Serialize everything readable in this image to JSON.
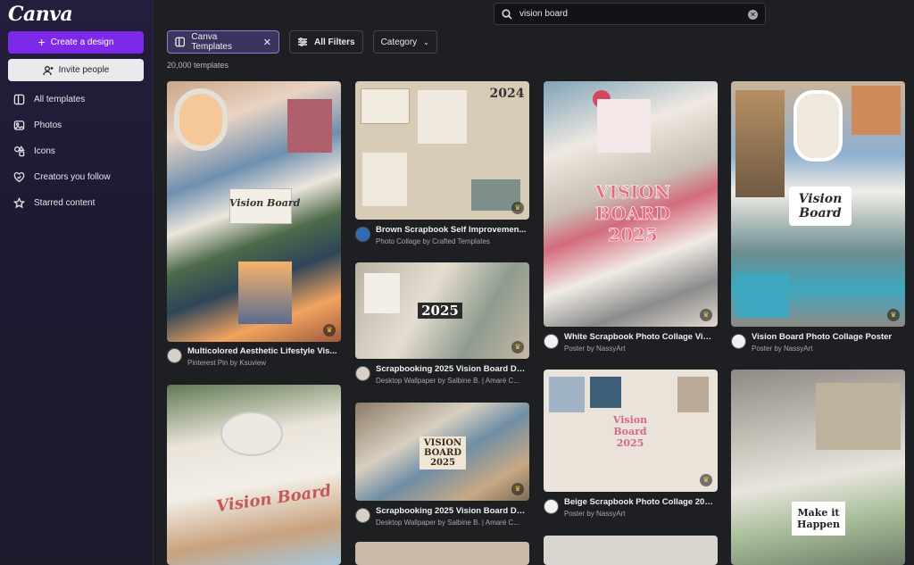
{
  "app": {
    "logo": "Canva",
    "create_label": "Create a design",
    "invite_label": "Invite people"
  },
  "sidebar": {
    "items": [
      {
        "label": "All templates",
        "icon": "templates-icon"
      },
      {
        "label": "Photos",
        "icon": "photos-icon"
      },
      {
        "label": "Icons",
        "icon": "shapes-icon"
      },
      {
        "label": "Creators you follow",
        "icon": "heart-follow-icon"
      },
      {
        "label": "Starred content",
        "icon": "star-icon"
      }
    ]
  },
  "search": {
    "value": "vision board"
  },
  "filters": {
    "active_chip": "Canva Templates",
    "all_filters": "All Filters",
    "category": "Category"
  },
  "results": {
    "count": "20,000 templates"
  },
  "cards": [
    {
      "title": "Multicolored Aesthetic Lifestyle Vis...",
      "sub": "Pinterest Pin by Ksuview",
      "thumb_text": "Vision Board"
    },
    {
      "title": "",
      "sub": "",
      "thumb_text": "Vision Board"
    },
    {
      "title": "Brown Scrapbook Self Improvemen...",
      "sub": "Photo Collage by Crafted Templates",
      "thumb_text": "2024"
    },
    {
      "title": "Scrapbooking 2025 Vision Board De...",
      "sub": "Desktop Wallpaper by Salbine B. | Amaré C...",
      "thumb_text": "2025"
    },
    {
      "title": "Scrapbooking 2025 Vision Board De...",
      "sub": "Desktop Wallpaper by Salbine B. | Amaré C...",
      "thumb_text": "VISION BOARD 2025"
    },
    {
      "title": "White Scrapbook Photo Collage Visi...",
      "sub": "Poster by NassyArt",
      "thumb_text": "VISION BOARD 2025"
    },
    {
      "title": "Beige Scrapbook Photo Collage 202...",
      "sub": "Poster by NassyArt",
      "thumb_text": "Vision Board 2025"
    },
    {
      "title": "Vision Board Photo Collage Poster",
      "sub": "Poster by NassyArt",
      "thumb_text": "Vision Board"
    },
    {
      "title": "",
      "sub": "",
      "thumb_text": "Make it Happen"
    }
  ],
  "colors": {
    "accent": "#7d2ae8",
    "background": "#1e1f22"
  }
}
